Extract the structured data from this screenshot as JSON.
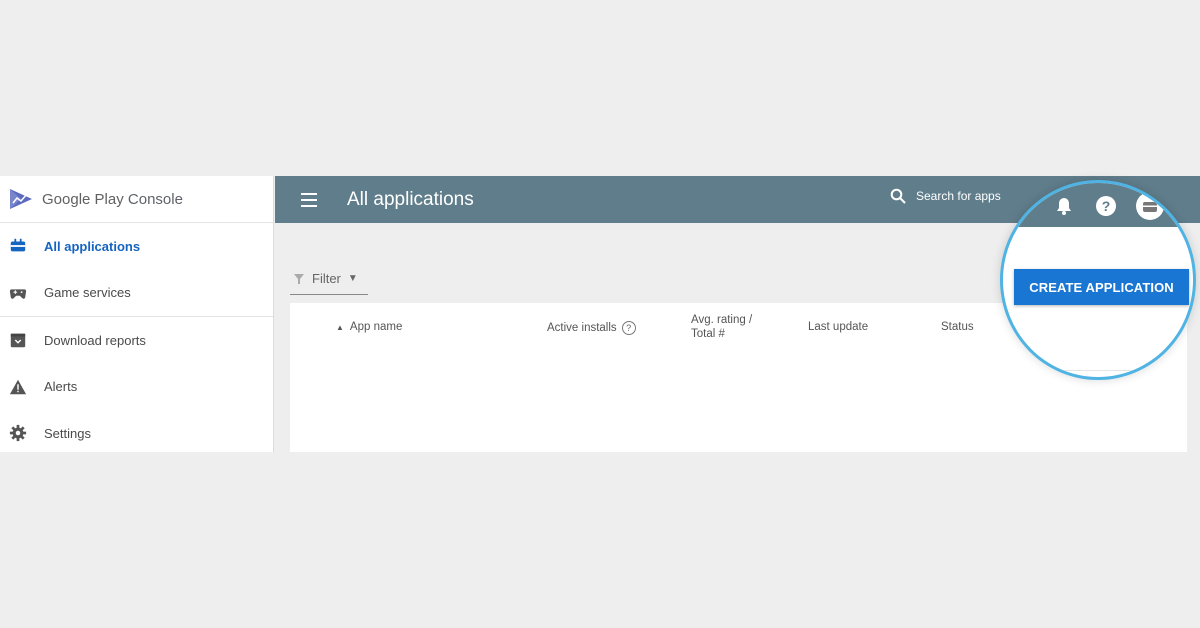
{
  "brand": {
    "name_part1": "Google Play",
    "name_part2": "Console"
  },
  "sidebar": {
    "items": [
      {
        "label": "All applications",
        "icon": "android-icon",
        "active": true
      },
      {
        "label": "Game services",
        "icon": "gamepad-icon",
        "active": false
      },
      {
        "label": "Download reports",
        "icon": "download-icon",
        "active": false
      },
      {
        "label": "Alerts",
        "icon": "alert-icon",
        "active": false
      },
      {
        "label": "Settings",
        "icon": "gear-icon",
        "active": false
      }
    ]
  },
  "header": {
    "title": "All applications",
    "search_label": "Search for apps"
  },
  "filter": {
    "label": "Filter"
  },
  "table": {
    "columns": {
      "app_name": "App name",
      "installs": "Active installs",
      "rating_line1": "Avg. rating /",
      "rating_line2": "Total #",
      "update": "Last update",
      "status": "Status"
    },
    "rows": []
  },
  "actions": {
    "create_label": "CREATE APPLICATION"
  },
  "colors": {
    "topbar": "#607d8b",
    "accent": "#1976d2",
    "highlight_ring": "#4fb3e3",
    "active_nav": "#1565c0"
  }
}
